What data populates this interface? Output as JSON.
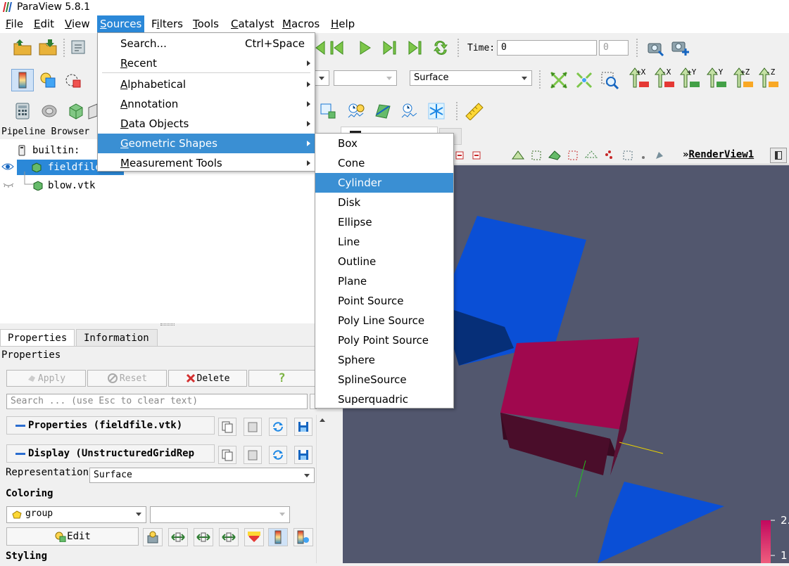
{
  "window": {
    "title": "ParaView 5.8.1"
  },
  "menubar": [
    {
      "label": "File",
      "mnemonic": "F",
      "rest": "ile"
    },
    {
      "label": "Edit",
      "mnemonic": "E",
      "rest": "dit"
    },
    {
      "label": "View",
      "mnemonic": "V",
      "rest": "iew"
    },
    {
      "label": "Sources",
      "mnemonic": "S",
      "rest": "ources",
      "active": true
    },
    {
      "label": "Filters",
      "mnemonic": "i",
      "pre": "F",
      "rest": "lters"
    },
    {
      "label": "Tools",
      "mnemonic": "T",
      "rest": "ools"
    },
    {
      "label": "Catalyst",
      "mnemonic": "C",
      "rest": "atalyst"
    },
    {
      "label": "Macros",
      "mnemonic": "M",
      "rest": "acros"
    },
    {
      "label": "Help",
      "mnemonic": "H",
      "rest": "elp"
    }
  ],
  "time": {
    "label": "Time:",
    "value": "0",
    "index": "0"
  },
  "representation_toolbar": {
    "value": "Surface"
  },
  "axes_buttons": [
    "+X",
    "-X",
    "+Y",
    "-Y",
    "+Z",
    "-Z"
  ],
  "pipeline": {
    "header": "Pipeline Browser",
    "items": [
      {
        "label": "builtin:"
      },
      {
        "label": "fieldfile.vtk"
      },
      {
        "label": "blow.vtk"
      }
    ]
  },
  "properties": {
    "tabs": [
      "Properties",
      "Information"
    ],
    "section_title": "Properties",
    "apply": "Apply",
    "reset": "Reset",
    "delete": "Delete",
    "help": "?",
    "search_placeholder": "Search ... (use Esc to clear text)",
    "group_properties": "Properties (fieldfile.vtk)",
    "group_display": "Display (UnstructuredGridRep",
    "representation_label": "Representation",
    "representation_value": "Surface",
    "coloring_label": "Coloring",
    "coloring_value": "group",
    "edit_button": "Edit",
    "styling_label": "Styling"
  },
  "render": {
    "view_name": "RenderView1",
    "colorbar_top": "2.",
    "colorbar_bottom": "1"
  },
  "sources_menu": [
    {
      "label": "Search...",
      "mnemonic": "",
      "shortcut": "Ctrl+Space"
    },
    {
      "label": "Recent",
      "mnemonic": "R",
      "rest": "ecent",
      "submenu": true
    },
    {
      "label": "Alphabetical",
      "mnemonic": "A",
      "rest": "lphabetical",
      "submenu": true
    },
    {
      "label": "Annotation",
      "mnemonic": "A",
      "rest": "nnotation",
      "submenu": true
    },
    {
      "label": "Data Objects",
      "mnemonic": "D",
      "rest": "ata Objects",
      "submenu": true
    },
    {
      "label": "Geometric Shapes",
      "mnemonic": "G",
      "rest": "eometric Shapes",
      "submenu": true,
      "highlight": true
    },
    {
      "label": "Measurement Tools",
      "mnemonic": "M",
      "rest": "easurement Tools",
      "submenu": true
    }
  ],
  "shapes_menu": [
    "Box",
    "Cone",
    "Cylinder",
    "Disk",
    "Ellipse",
    "Line",
    "Outline",
    "Plane",
    "Point Source",
    "Poly Line Source",
    "Poly Point Source",
    "Sphere",
    "SplineSource",
    "Superquadric"
  ],
  "shapes_highlight": "Cylinder",
  "colors": {
    "highlight": "#3a8fd3",
    "render_bg": "#52576e",
    "magenta": "#a0084e",
    "blue": "#0a4fd6"
  }
}
